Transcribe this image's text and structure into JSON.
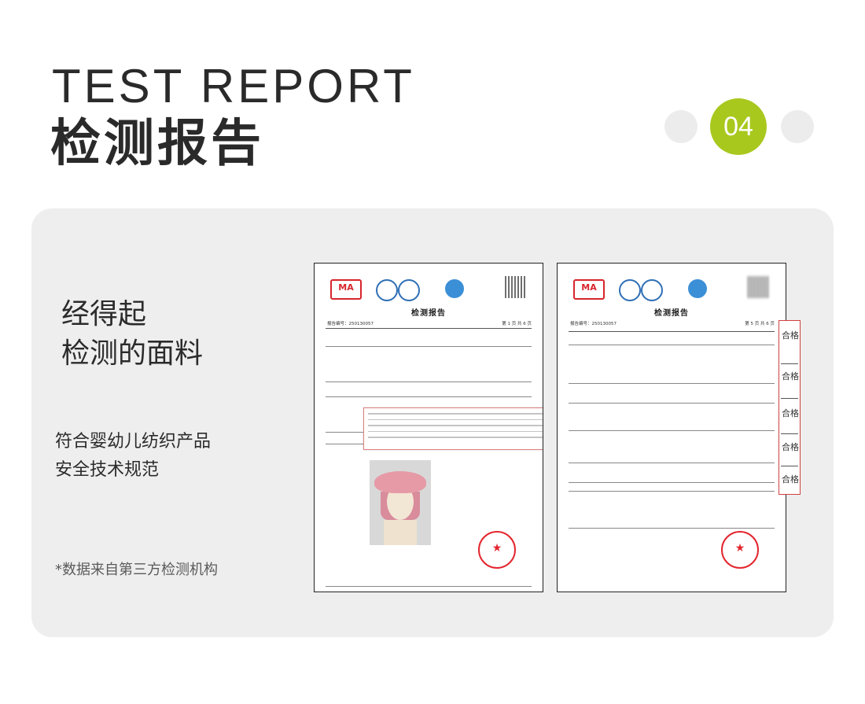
{
  "header": {
    "title_en": "TEST REPORT",
    "title_cn": "检测报告",
    "page_number": "04"
  },
  "left": {
    "slogan_line1": "经得起",
    "slogan_line2": "检测的面料",
    "standard_line1": "符合婴幼儿纺织产品",
    "standard_line2": "安全技术规范",
    "note": "*数据来自第三方检测机构"
  },
  "report1": {
    "title": "检测报告",
    "report_no": "报告编号：250130057",
    "page_info": "第 1 页 共 6 页"
  },
  "report2": {
    "title": "检测报告",
    "report_no": "报告编号：250130057",
    "page_info": "第 5 页 共 6 页",
    "verdicts": [
      "合格",
      "合格",
      "合格",
      "合格",
      "合格"
    ]
  },
  "colors": {
    "accent": "#a8c81e",
    "panel": "#eeeeee",
    "highlight": "#d04040"
  }
}
